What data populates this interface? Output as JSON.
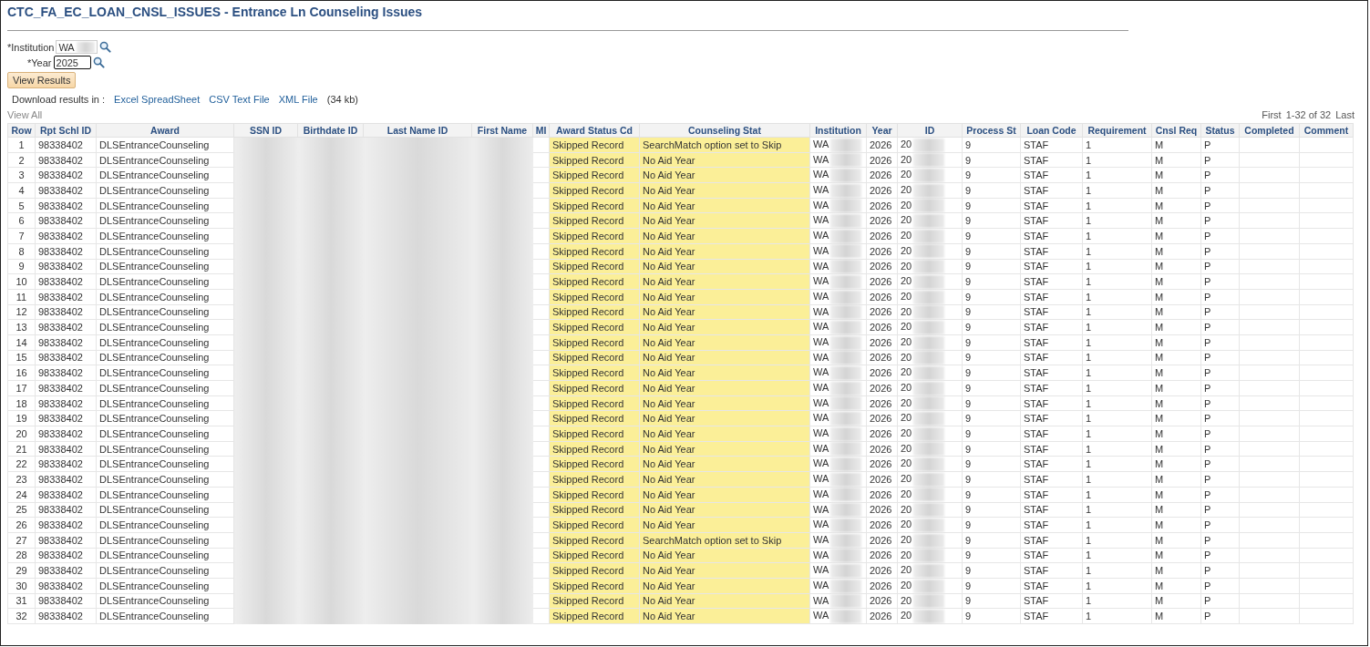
{
  "title": "CTC_FA_EC_LOAN_CNSL_ISSUES - Entrance Ln Counseling Issues",
  "prompts": [
    {
      "label": "*Institution",
      "value": "WA",
      "redacted": true,
      "focused": false
    },
    {
      "label": "*Year",
      "value": "2025",
      "redacted": false,
      "focused": true
    }
  ],
  "view_results_button": "View Results",
  "download": {
    "label": "Download results in :",
    "links": [
      "Excel SpreadSheet",
      "CSV Text File",
      "XML File"
    ],
    "size": "(34 kb)"
  },
  "view_all": "View All",
  "pager": {
    "first": "First",
    "range": "1-32 of 32",
    "last": "Last"
  },
  "columns": [
    {
      "label": "Row",
      "kind": "center",
      "highlighted": false
    },
    {
      "label": "Rpt Schl ID",
      "kind": "text",
      "highlighted": false
    },
    {
      "label": "Award",
      "kind": "text",
      "highlighted": false
    },
    {
      "label": "SSN ID",
      "kind": "redacted",
      "highlighted": false
    },
    {
      "label": "Birthdate ID",
      "kind": "redacted",
      "highlighted": false
    },
    {
      "label": "Last Name ID",
      "kind": "redacted",
      "highlighted": false
    },
    {
      "label": "First Name",
      "kind": "redacted",
      "highlighted": false
    },
    {
      "label": "MI",
      "kind": "empty",
      "highlighted": false
    },
    {
      "label": "Award Status Cd",
      "kind": "text",
      "highlighted": true
    },
    {
      "label": "Counseling Stat",
      "kind": "text",
      "highlighted": true
    },
    {
      "label": "Institution",
      "kind": "partial",
      "highlighted": false
    },
    {
      "label": "Year",
      "kind": "text",
      "highlighted": false
    },
    {
      "label": "ID",
      "kind": "partial",
      "highlighted": false
    },
    {
      "label": "Process St",
      "kind": "text",
      "highlighted": false
    },
    {
      "label": "Loan Code",
      "kind": "text",
      "highlighted": false
    },
    {
      "label": "Requirement",
      "kind": "text",
      "highlighted": false
    },
    {
      "label": "Cnsl Req",
      "kind": "text",
      "highlighted": false
    },
    {
      "label": "Status",
      "kind": "text",
      "highlighted": false
    },
    {
      "label": "Completed",
      "kind": "empty",
      "highlighted": false
    },
    {
      "label": "Comment",
      "kind": "empty",
      "highlighted": false
    }
  ],
  "rows": [
    {
      "cells": [
        "1",
        "98338402",
        "DLSEntranceCounseling",
        "Skipped Record",
        "SearchMatch option set to Skip",
        "WA",
        "2026",
        "20",
        "9",
        "STAF",
        "1",
        "M",
        "P"
      ]
    },
    {
      "cells": [
        "2",
        "98338402",
        "DLSEntranceCounseling",
        "Skipped Record",
        "No Aid Year",
        "WA",
        "2026",
        "20",
        "9",
        "STAF",
        "1",
        "M",
        "P"
      ]
    },
    {
      "cells": [
        "3",
        "98338402",
        "DLSEntranceCounseling",
        "Skipped Record",
        "No Aid Year",
        "WA",
        "2026",
        "20",
        "9",
        "STAF",
        "1",
        "M",
        "P"
      ]
    },
    {
      "cells": [
        "4",
        "98338402",
        "DLSEntranceCounseling",
        "Skipped Record",
        "No Aid Year",
        "WA",
        "2026",
        "20",
        "9",
        "STAF",
        "1",
        "M",
        "P"
      ]
    },
    {
      "cells": [
        "5",
        "98338402",
        "DLSEntranceCounseling",
        "Skipped Record",
        "No Aid Year",
        "WA",
        "2026",
        "20",
        "9",
        "STAF",
        "1",
        "M",
        "P"
      ]
    },
    {
      "cells": [
        "6",
        "98338402",
        "DLSEntranceCounseling",
        "Skipped Record",
        "No Aid Year",
        "WA",
        "2026",
        "20",
        "9",
        "STAF",
        "1",
        "M",
        "P"
      ]
    },
    {
      "cells": [
        "7",
        "98338402",
        "DLSEntranceCounseling",
        "Skipped Record",
        "No Aid Year",
        "WA",
        "2026",
        "20",
        "9",
        "STAF",
        "1",
        "M",
        "P"
      ]
    },
    {
      "cells": [
        "8",
        "98338402",
        "DLSEntranceCounseling",
        "Skipped Record",
        "No Aid Year",
        "WA",
        "2026",
        "20",
        "9",
        "STAF",
        "1",
        "M",
        "P"
      ]
    },
    {
      "cells": [
        "9",
        "98338402",
        "DLSEntranceCounseling",
        "Skipped Record",
        "No Aid Year",
        "WA",
        "2026",
        "20",
        "9",
        "STAF",
        "1",
        "M",
        "P"
      ]
    },
    {
      "cells": [
        "10",
        "98338402",
        "DLSEntranceCounseling",
        "Skipped Record",
        "No Aid Year",
        "WA",
        "2026",
        "20",
        "9",
        "STAF",
        "1",
        "M",
        "P"
      ]
    },
    {
      "cells": [
        "11",
        "98338402",
        "DLSEntranceCounseling",
        "Skipped Record",
        "No Aid Year",
        "WA",
        "2026",
        "20",
        "9",
        "STAF",
        "1",
        "M",
        "P"
      ]
    },
    {
      "cells": [
        "12",
        "98338402",
        "DLSEntranceCounseling",
        "Skipped Record",
        "No Aid Year",
        "WA",
        "2026",
        "20",
        "9",
        "STAF",
        "1",
        "M",
        "P"
      ]
    },
    {
      "cells": [
        "13",
        "98338402",
        "DLSEntranceCounseling",
        "Skipped Record",
        "No Aid Year",
        "WA",
        "2026",
        "20",
        "9",
        "STAF",
        "1",
        "M",
        "P"
      ]
    },
    {
      "cells": [
        "14",
        "98338402",
        "DLSEntranceCounseling",
        "Skipped Record",
        "No Aid Year",
        "WA",
        "2026",
        "20",
        "9",
        "STAF",
        "1",
        "M",
        "P"
      ]
    },
    {
      "cells": [
        "15",
        "98338402",
        "DLSEntranceCounseling",
        "Skipped Record",
        "No Aid Year",
        "WA",
        "2026",
        "20",
        "9",
        "STAF",
        "1",
        "M",
        "P"
      ]
    },
    {
      "cells": [
        "16",
        "98338402",
        "DLSEntranceCounseling",
        "Skipped Record",
        "No Aid Year",
        "WA",
        "2026",
        "20",
        "9",
        "STAF",
        "1",
        "M",
        "P"
      ]
    },
    {
      "cells": [
        "17",
        "98338402",
        "DLSEntranceCounseling",
        "Skipped Record",
        "No Aid Year",
        "WA",
        "2026",
        "20",
        "9",
        "STAF",
        "1",
        "M",
        "P"
      ]
    },
    {
      "cells": [
        "18",
        "98338402",
        "DLSEntranceCounseling",
        "Skipped Record",
        "No Aid Year",
        "WA",
        "2026",
        "20",
        "9",
        "STAF",
        "1",
        "M",
        "P"
      ]
    },
    {
      "cells": [
        "19",
        "98338402",
        "DLSEntranceCounseling",
        "Skipped Record",
        "No Aid Year",
        "WA",
        "2026",
        "20",
        "9",
        "STAF",
        "1",
        "M",
        "P"
      ]
    },
    {
      "cells": [
        "20",
        "98338402",
        "DLSEntranceCounseling",
        "Skipped Record",
        "No Aid Year",
        "WA",
        "2026",
        "20",
        "9",
        "STAF",
        "1",
        "M",
        "P"
      ]
    },
    {
      "cells": [
        "21",
        "98338402",
        "DLSEntranceCounseling",
        "Skipped Record",
        "No Aid Year",
        "WA",
        "2026",
        "20",
        "9",
        "STAF",
        "1",
        "M",
        "P"
      ]
    },
    {
      "cells": [
        "22",
        "98338402",
        "DLSEntranceCounseling",
        "Skipped Record",
        "No Aid Year",
        "WA",
        "2026",
        "20",
        "9",
        "STAF",
        "1",
        "M",
        "P"
      ]
    },
    {
      "cells": [
        "23",
        "98338402",
        "DLSEntranceCounseling",
        "Skipped Record",
        "No Aid Year",
        "WA",
        "2026",
        "20",
        "9",
        "STAF",
        "1",
        "M",
        "P"
      ]
    },
    {
      "cells": [
        "24",
        "98338402",
        "DLSEntranceCounseling",
        "Skipped Record",
        "No Aid Year",
        "WA",
        "2026",
        "20",
        "9",
        "STAF",
        "1",
        "M",
        "P"
      ]
    },
    {
      "cells": [
        "25",
        "98338402",
        "DLSEntranceCounseling",
        "Skipped Record",
        "No Aid Year",
        "WA",
        "2026",
        "20",
        "9",
        "STAF",
        "1",
        "M",
        "P"
      ]
    },
    {
      "cells": [
        "26",
        "98338402",
        "DLSEntranceCounseling",
        "Skipped Record",
        "No Aid Year",
        "WA",
        "2026",
        "20",
        "9",
        "STAF",
        "1",
        "M",
        "P"
      ]
    },
    {
      "cells": [
        "27",
        "98338402",
        "DLSEntranceCounseling",
        "Skipped Record",
        "SearchMatch option set to Skip",
        "WA",
        "2026",
        "20",
        "9",
        "STAF",
        "1",
        "M",
        "P"
      ]
    },
    {
      "cells": [
        "28",
        "98338402",
        "DLSEntranceCounseling",
        "Skipped Record",
        "No Aid Year",
        "WA",
        "2026",
        "20",
        "9",
        "STAF",
        "1",
        "M",
        "P"
      ]
    },
    {
      "cells": [
        "29",
        "98338402",
        "DLSEntranceCounseling",
        "Skipped Record",
        "No Aid Year",
        "WA",
        "2026",
        "20",
        "9",
        "STAF",
        "1",
        "M",
        "P"
      ]
    },
    {
      "cells": [
        "30",
        "98338402",
        "DLSEntranceCounseling",
        "Skipped Record",
        "No Aid Year",
        "WA",
        "2026",
        "20",
        "9",
        "STAF",
        "1",
        "M",
        "P"
      ]
    },
    {
      "cells": [
        "31",
        "98338402",
        "DLSEntranceCounseling",
        "Skipped Record",
        "No Aid Year",
        "WA",
        "2026",
        "20",
        "9",
        "STAF",
        "1",
        "M",
        "P"
      ]
    },
    {
      "cells": [
        "32",
        "98338402",
        "DLSEntranceCounseling",
        "Skipped Record",
        "No Aid Year",
        "WA",
        "2026",
        "20",
        "9",
        "STAF",
        "1",
        "M",
        "P"
      ]
    }
  ]
}
